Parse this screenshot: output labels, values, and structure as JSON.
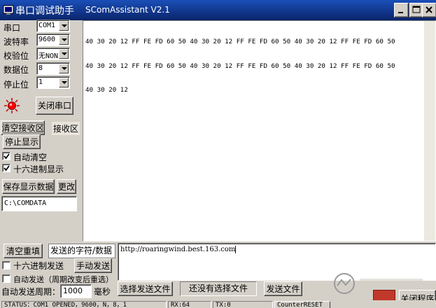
{
  "window": {
    "title_cn": "串口调试助手",
    "title_en": "SComAssistant V2.1"
  },
  "settings": {
    "port_label": "串口",
    "port_value": "COM1",
    "baud_label": "波特率",
    "baud_value": "9600",
    "parity_label": "校验位",
    "parity_value": "无NONE",
    "databits_label": "数据位",
    "databits_value": "8",
    "stopbits_label": "停止位",
    "stopbits_value": "1"
  },
  "controls": {
    "close_port": "关闭串口",
    "clear_receive": "清空接收区",
    "receive_area_label": "接收区",
    "stop_display": "停止显示",
    "auto_clear": "自动清空",
    "hex_display": "十六进制显示",
    "save_data": "保存显示数据",
    "change": "更改",
    "save_path": "C:\\COMDATA"
  },
  "receive": {
    "lines": [
      "40 30 20 12 FF FE FD 60 50 40 30 20 12 FF FE FD 60 50 40 30 20 12 FF FE FD 60 50",
      "40 30 20 12 FF FE FD 60 50 40 30 20 12 FF FE FD 60 50 40 30 20 12 FF FE FD 60 50",
      "40 30 20 12"
    ]
  },
  "send": {
    "clear_resend": "清空重填",
    "sent_chars_label": "发送的字符/数据",
    "hex_send": "十六进制发送",
    "manual_send": "手动发送",
    "auto_send": "自动发送（周期改变后重选）",
    "period_label": "自动发送周期：",
    "period_value": "1000",
    "period_unit": "毫秒",
    "choose_file": "选择发送文件",
    "no_file": "还没有选择文件",
    "send_file": "发送文件",
    "input_text": "http://roaringwind.best.163.com"
  },
  "status": {
    "status_text": "STATUS：COM1 OPENED，9600，N，8，1",
    "rx": "RX:64",
    "tx": "TX:0",
    "counter_reset": "CounterRESET",
    "close_program": "关闭程序"
  },
  "colors": {
    "title_bar": "#0a246a",
    "face": "#d4d0c8",
    "indicator": "#ff0000",
    "accent_badge": "#c0392b"
  }
}
